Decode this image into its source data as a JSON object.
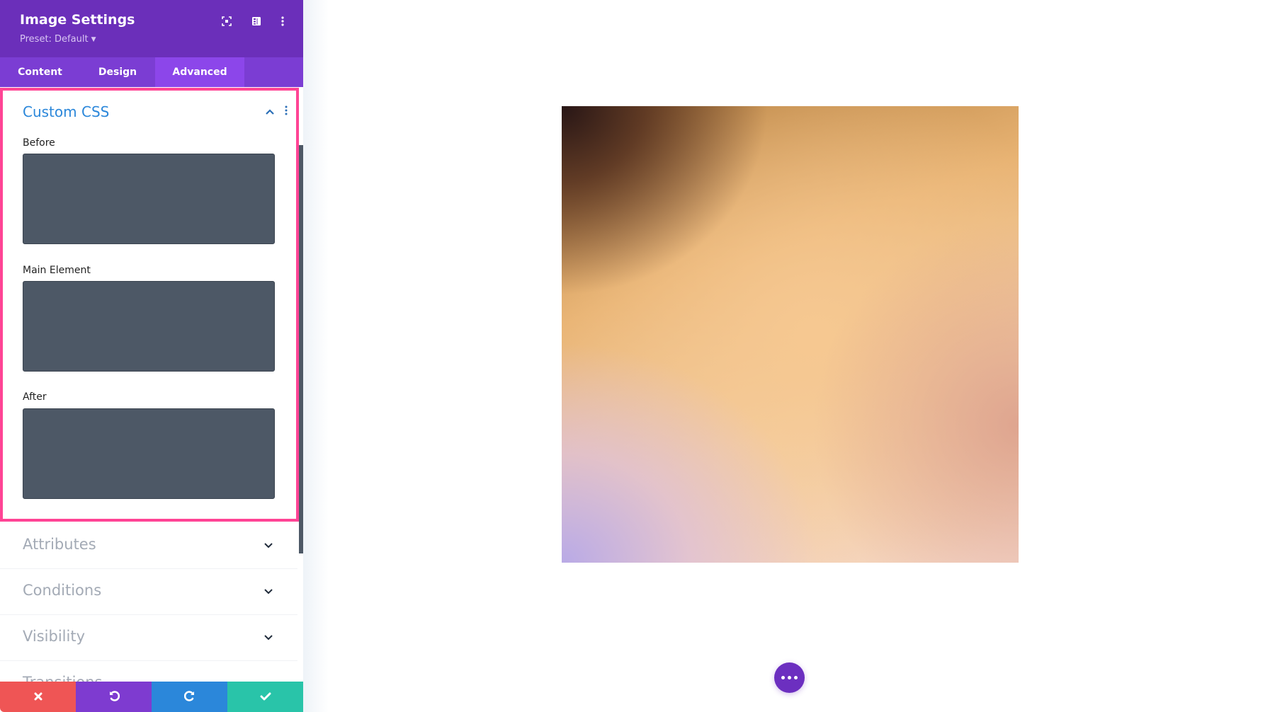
{
  "header": {
    "title": "Image Settings",
    "preset_label": "Preset: Default",
    "icons": [
      "fullscreen-icon",
      "split-view-icon",
      "more-options-icon"
    ]
  },
  "tabs": [
    {
      "label": "Content",
      "active": false
    },
    {
      "label": "Design",
      "active": false
    },
    {
      "label": "Advanced",
      "active": true
    }
  ],
  "custom_css": {
    "title": "Custom CSS",
    "fields": [
      {
        "label": "Before",
        "value": ""
      },
      {
        "label": "Main Element",
        "value": ""
      },
      {
        "label": "After",
        "value": ""
      }
    ]
  },
  "sections": [
    {
      "label": "Attributes"
    },
    {
      "label": "Conditions"
    },
    {
      "label": "Visibility"
    },
    {
      "label": "Transitions"
    }
  ],
  "bottom_bar": {
    "cancel": {
      "icon": "close-icon",
      "color": "#ef5555"
    },
    "undo": {
      "icon": "undo-icon",
      "color": "#7e3bd0"
    },
    "redo": {
      "icon": "redo-icon",
      "color": "#2b87da"
    },
    "save": {
      "icon": "check-icon",
      "color": "#29c4a9"
    }
  },
  "colors": {
    "header": "#6b2fba",
    "tab_bar": "#7b3dd3",
    "active_tab": "#8c46ea",
    "highlight_border": "#ff4495",
    "accent_blue": "#2b87da",
    "fab": "#6c2fc0"
  }
}
